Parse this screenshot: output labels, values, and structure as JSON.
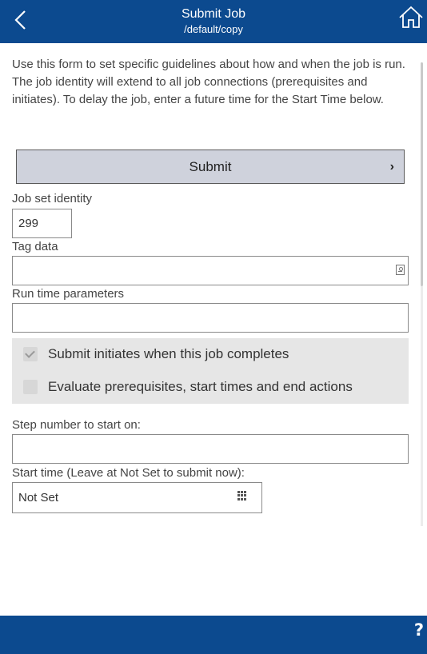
{
  "header": {
    "title": "Submit Job",
    "subtitle": "/default/copy",
    "back_icon": "back-chevron-icon",
    "home_icon": "home-icon",
    "background": "#0c4a8f"
  },
  "intro": "Use this form to set specific guidelines about how and when the job is run. The job identity will extend to all job connections (prerequisites and initiates). To delay the job, enter a future time for the Start Time below.",
  "submit": {
    "label": "Submit",
    "icon": "chevron-right-icon",
    "chevron": "›"
  },
  "job_set_identity": {
    "label": "Job set identity",
    "value": "299"
  },
  "tag_data": {
    "label": "Tag data",
    "value": "",
    "icon": "tag-picker-icon"
  },
  "run_time_parameters": {
    "label": "Run time parameters",
    "value": ""
  },
  "options": [
    {
      "label": "Submit initiates when this job completes",
      "checked": true
    },
    {
      "label": "Evaluate prerequisites, start times and end actions",
      "checked": false
    }
  ],
  "step_number": {
    "label": "Step number to start on:",
    "value": ""
  },
  "start_time": {
    "label": "Start time (Leave at Not Set to submit now):",
    "value": "Not Set",
    "icon": "calendar-icon"
  },
  "footer": {
    "help": "?",
    "help_icon": "help-icon"
  }
}
